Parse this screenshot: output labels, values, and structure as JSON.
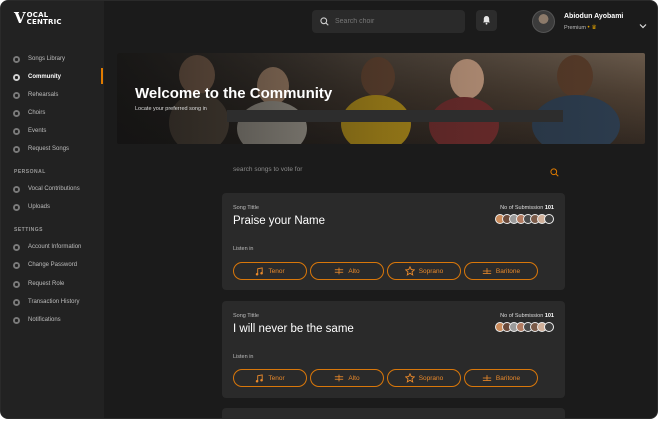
{
  "brand": {
    "mark": "V",
    "line1": "OCAL",
    "line2": "CENTRIC"
  },
  "sidebar": {
    "items": [
      {
        "label": "Songs Library",
        "icon": "music-library-icon"
      },
      {
        "label": "Community",
        "icon": "community-icon",
        "active": true
      },
      {
        "label": "Rehearsals",
        "icon": "rehearsal-icon"
      },
      {
        "label": "Choirs",
        "icon": "choir-icon"
      },
      {
        "label": "Events",
        "icon": "calendar-icon"
      },
      {
        "label": "Request Songs",
        "icon": "request-icon"
      }
    ],
    "personal_heading": "PERSONAL",
    "personal": [
      {
        "label": "Vocal Contributions",
        "icon": "microphone-icon"
      },
      {
        "label": "Uploads",
        "icon": "upload-icon"
      }
    ],
    "settings_heading": "SETTINGS",
    "settings": [
      {
        "label": "Account Information",
        "icon": "user-icon"
      },
      {
        "label": "Change Password",
        "icon": "lock-icon"
      },
      {
        "label": "Request Role",
        "icon": "role-icon"
      },
      {
        "label": "Transaction History",
        "icon": "history-icon"
      },
      {
        "label": "Notifications",
        "icon": "notification-icon"
      }
    ]
  },
  "topbar": {
    "search_placeholder": "Search choir",
    "user_name": "Abiodun Ayobami",
    "user_tier": "Premium",
    "tier_icon": "crown-icon"
  },
  "hero": {
    "title": "Welcome to the Community",
    "subtitle": "Locate your preferred song in"
  },
  "vote_search": {
    "placeholder": "search songs to vote for"
  },
  "accent": "#e07b00",
  "cards": [
    {
      "song_label": "Song Tittle",
      "title": "Praise your Name",
      "submissions_label": "No of Submission",
      "submissions_count": "101",
      "listen_label": "Listen in",
      "voices": [
        "Tenor",
        "Alto",
        "Soprano",
        "Baritone"
      ]
    },
    {
      "song_label": "Song Tittle",
      "title": "I will never be the same",
      "submissions_label": "No of Submission",
      "submissions_count": "101",
      "listen_label": "Listen in",
      "voices": [
        "Tenor",
        "Alto",
        "Soprano",
        "Baritone"
      ]
    }
  ]
}
